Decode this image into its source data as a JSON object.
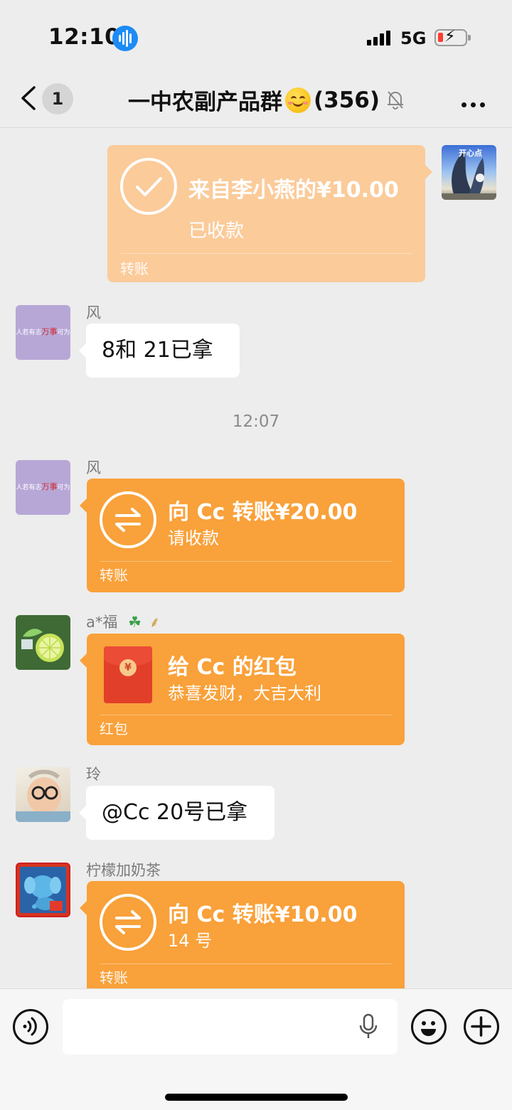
{
  "status_bar": {
    "time": "12:10",
    "network": "5G",
    "battery_level_fraction": 0.15,
    "battery_charging": true
  },
  "nav": {
    "back_icon": "chevron-left-icon",
    "unread_count": "1",
    "title_text": "一中农副产品群",
    "title_count": "(356)",
    "mute_icon": "bell-slash-icon",
    "more_icon": "ellipsis-icon"
  },
  "messages": {
    "m1": {
      "main": "来自李小燕的¥10.00",
      "status": "已收款",
      "footer": "转账"
    },
    "m2": {
      "sender": "风",
      "text": "8和 21已拿"
    },
    "timestamp": "12:07",
    "m3": {
      "sender": "风",
      "main": "向 Cc 转账¥20.00",
      "sub": "请收款",
      "footer": "转账"
    },
    "m4": {
      "sender": "a*福",
      "sender_icons": [
        "clover-icon",
        "rice-icon"
      ],
      "main": "给 Cc 的红包",
      "sub": "恭喜发财，大吉大利",
      "footer": "红包"
    },
    "m5": {
      "sender": "玲",
      "text": "@Cc 20号已拿"
    },
    "m6": {
      "sender": "柠檬加奶茶",
      "main": "向 Cc 转账¥10.00",
      "sub": "14 号",
      "footer": "转账"
    }
  },
  "avatar_texts": {
    "feng_left": "人若有志",
    "feng_mid": "万事",
    "feng_right": "可为",
    "self_caption": "开心点"
  },
  "colors": {
    "transfer_orange": "#f9a13a",
    "received_peach": "#fbcb9a",
    "chat_bg": "#ededed",
    "red_packet": "#e23f2a"
  },
  "input_bar": {
    "voice_icon": "voice-mode-icon",
    "mic_icon": "microphone-icon",
    "emoji_icon": "smiley-icon",
    "plus_icon": "plus-icon"
  }
}
